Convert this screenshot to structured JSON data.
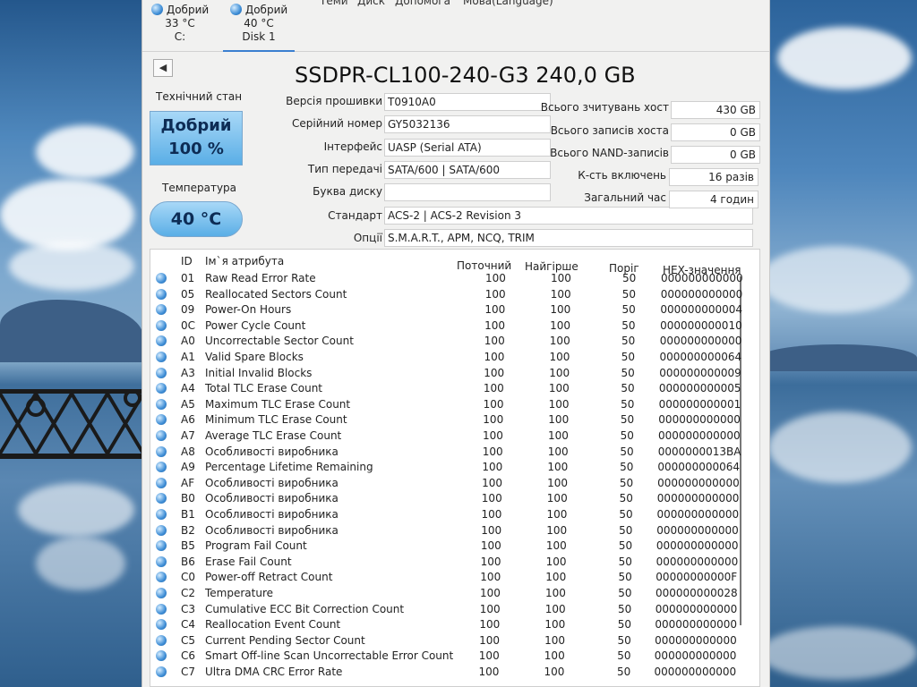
{
  "menu": [
    "Теми",
    "Диск",
    "Допомога",
    "Мова(Language)"
  ],
  "disk_tabs": [
    {
      "status": "Добрий",
      "temp": "33 °C",
      "name": "C:"
    },
    {
      "status": "Добрий",
      "temp": "40 °C",
      "name": "Disk 1"
    }
  ],
  "header": {
    "title": "SSDPR-CL100-240-G3 240,0 GB",
    "back": "◀"
  },
  "health": {
    "label": "Технічний стан",
    "status": "Добрий",
    "percent": "100 %"
  },
  "temperature": {
    "label": "Температура",
    "value": "40 °C"
  },
  "info": {
    "firmware_label": "Версія прошивки",
    "firmware": "T0910A0",
    "serial_label": "Серійний номер",
    "serial": "GY5032136",
    "interface_label": "Інтерфейс",
    "interface": "UASP (Serial ATA)",
    "transfer_label": "Тип передачі",
    "transfer": "SATA/600 | SATA/600",
    "drive_letter_label": "Буква диску",
    "drive_letter": "",
    "standard_label": "Стандарт",
    "standard": "ACS-2 | ACS-2 Revision 3",
    "features_label": "Опції",
    "features": "S.M.A.R.T., APM, NCQ, TRIM"
  },
  "stats": {
    "host_reads_label": "Всього зчитувань хост",
    "host_reads": "430 GB",
    "host_writes_label": "Всього записів хоста",
    "host_writes": "0 GB",
    "nand_writes_label": "Всього NAND-записів",
    "nand_writes": "0 GB",
    "power_count_label": "К-сть включень",
    "power_count": "16 разів",
    "power_hours_label": "Загальний час",
    "power_hours": "4 годин"
  },
  "smart": {
    "headers": {
      "id": "ID",
      "name": "Ім`я атрибута",
      "current": "Поточний",
      "worst": "Найгірше",
      "threshold": "Поріг",
      "raw": "HEX-значення"
    },
    "rows": [
      {
        "id": "01",
        "name": "Raw Read Error Rate",
        "current": "100",
        "worst": "100",
        "threshold": "50",
        "raw": "000000000000"
      },
      {
        "id": "05",
        "name": "Reallocated Sectors Count",
        "current": "100",
        "worst": "100",
        "threshold": "50",
        "raw": "000000000000"
      },
      {
        "id": "09",
        "name": "Power-On Hours",
        "current": "100",
        "worst": "100",
        "threshold": "50",
        "raw": "000000000004"
      },
      {
        "id": "0C",
        "name": "Power Cycle Count",
        "current": "100",
        "worst": "100",
        "threshold": "50",
        "raw": "000000000010"
      },
      {
        "id": "A0",
        "name": "Uncorrectable Sector Count",
        "current": "100",
        "worst": "100",
        "threshold": "50",
        "raw": "000000000000"
      },
      {
        "id": "A1",
        "name": "Valid Spare Blocks",
        "current": "100",
        "worst": "100",
        "threshold": "50",
        "raw": "000000000064"
      },
      {
        "id": "A3",
        "name": "Initial Invalid Blocks",
        "current": "100",
        "worst": "100",
        "threshold": "50",
        "raw": "000000000009"
      },
      {
        "id": "A4",
        "name": "Total TLC Erase Count",
        "current": "100",
        "worst": "100",
        "threshold": "50",
        "raw": "000000000005"
      },
      {
        "id": "A5",
        "name": "Maximum TLC Erase Count",
        "current": "100",
        "worst": "100",
        "threshold": "50",
        "raw": "000000000001"
      },
      {
        "id": "A6",
        "name": "Minimum TLC Erase Count",
        "current": "100",
        "worst": "100",
        "threshold": "50",
        "raw": "000000000000"
      },
      {
        "id": "A7",
        "name": "Average TLC Erase Count",
        "current": "100",
        "worst": "100",
        "threshold": "50",
        "raw": "000000000000"
      },
      {
        "id": "A8",
        "name": "Особливості виробника",
        "current": "100",
        "worst": "100",
        "threshold": "50",
        "raw": "0000000013BA"
      },
      {
        "id": "A9",
        "name": "Percentage Lifetime Remaining",
        "current": "100",
        "worst": "100",
        "threshold": "50",
        "raw": "000000000064"
      },
      {
        "id": "AF",
        "name": "Особливості виробника",
        "current": "100",
        "worst": "100",
        "threshold": "50",
        "raw": "000000000000"
      },
      {
        "id": "B0",
        "name": "Особливості виробника",
        "current": "100",
        "worst": "100",
        "threshold": "50",
        "raw": "000000000000"
      },
      {
        "id": "B1",
        "name": "Особливості виробника",
        "current": "100",
        "worst": "100",
        "threshold": "50",
        "raw": "000000000000"
      },
      {
        "id": "B2",
        "name": "Особливості виробника",
        "current": "100",
        "worst": "100",
        "threshold": "50",
        "raw": "000000000000"
      },
      {
        "id": "B5",
        "name": "Program Fail Count",
        "current": "100",
        "worst": "100",
        "threshold": "50",
        "raw": "000000000000"
      },
      {
        "id": "B6",
        "name": "Erase Fail Count",
        "current": "100",
        "worst": "100",
        "threshold": "50",
        "raw": "000000000000"
      },
      {
        "id": "C0",
        "name": "Power-off Retract Count",
        "current": "100",
        "worst": "100",
        "threshold": "50",
        "raw": "00000000000F"
      },
      {
        "id": "C2",
        "name": "Temperature",
        "current": "100",
        "worst": "100",
        "threshold": "50",
        "raw": "000000000028"
      },
      {
        "id": "C3",
        "name": "Cumulative ECC Bit Correction Count",
        "current": "100",
        "worst": "100",
        "threshold": "50",
        "raw": "000000000000"
      },
      {
        "id": "C4",
        "name": "Reallocation Event Count",
        "current": "100",
        "worst": "100",
        "threshold": "50",
        "raw": "000000000000"
      },
      {
        "id": "C5",
        "name": "Current Pending Sector Count",
        "current": "100",
        "worst": "100",
        "threshold": "50",
        "raw": "000000000000"
      },
      {
        "id": "C6",
        "name": "Smart Off-line Scan Uncorrectable Error Count",
        "current": "100",
        "worst": "100",
        "threshold": "50",
        "raw": "000000000000"
      },
      {
        "id": "C7",
        "name": "Ultra DMA CRC Error Rate",
        "current": "100",
        "worst": "100",
        "threshold": "50",
        "raw": "000000000000"
      }
    ]
  }
}
